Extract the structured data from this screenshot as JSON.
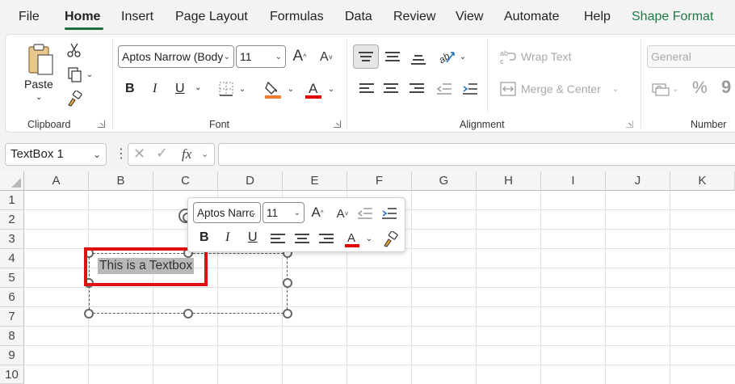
{
  "menu": {
    "tabs": [
      {
        "label": "File",
        "active": false
      },
      {
        "label": "Home",
        "active": true
      },
      {
        "label": "Insert",
        "active": false
      },
      {
        "label": "Page Layout",
        "active": false
      },
      {
        "label": "Formulas",
        "active": false
      },
      {
        "label": "Data",
        "active": false
      },
      {
        "label": "Review",
        "active": false
      },
      {
        "label": "View",
        "active": false
      },
      {
        "label": "Automate",
        "active": false
      },
      {
        "label": "Help",
        "active": false
      },
      {
        "label": "Shape Format",
        "active": false
      }
    ]
  },
  "ribbon": {
    "clipboard": {
      "paste_label": "Paste",
      "group_label": "Clipboard"
    },
    "font": {
      "font_name": "Aptos Narrow (Body)",
      "font_size": "11",
      "bold": "B",
      "italic": "I",
      "underline": "U",
      "group_label": "Font",
      "fill_color": "#ed7d31",
      "font_color": "#e00000"
    },
    "alignment": {
      "wrap_text": "Wrap Text",
      "merge_center": "Merge & Center",
      "group_label": "Alignment"
    },
    "number": {
      "format": "General",
      "percent": "%",
      "group_label": "Number"
    }
  },
  "formula_bar": {
    "name_box": "TextBox 1",
    "fx": "fx",
    "formula": ""
  },
  "grid": {
    "columns": [
      "A",
      "B",
      "C",
      "D",
      "E",
      "F",
      "G",
      "H",
      "I",
      "J",
      "K"
    ],
    "rows": [
      "1",
      "2",
      "3",
      "4",
      "5",
      "6",
      "7",
      "8",
      "9",
      "10"
    ]
  },
  "textbox": {
    "text": "This is a Textbox"
  },
  "mini_toolbar": {
    "font_name": "Aptos Narrow",
    "font_size": "11",
    "bold": "B",
    "italic": "I",
    "underline": "U",
    "font_color": "#e00000"
  },
  "colors": {
    "accent_green": "#1e6b3c",
    "highlight_red": "#e01010"
  }
}
